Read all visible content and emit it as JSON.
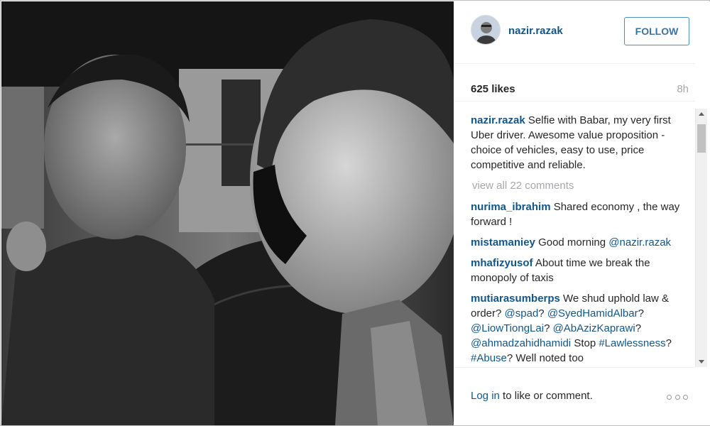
{
  "post": {
    "username": "nazir.razak",
    "follow_label": "FOLLOW",
    "likes": "625 likes",
    "time_ago": "8h",
    "caption_user": "nazir.razak",
    "caption_text": "Selfie with Babar, my very first Uber driver. Awesome value proposition - choice of vehicles, easy to use, price competitive and reliable.",
    "view_all": "view all 22 comments"
  },
  "comments": [
    {
      "user": "nurima_ibrahim",
      "text": "Shared economy , the way forward !"
    },
    {
      "user": "mistamaniey",
      "text": "Good morning",
      "mention": "@nazir.razak"
    },
    {
      "user": "mhafizyusof",
      "text": "About time we break the monopoly of taxis"
    }
  ],
  "long_comment": {
    "user": "mutiarasumberps",
    "t1": "We shud uphold law & order?",
    "m1": "@spad",
    "t2": "?",
    "m2": "@SyedHamidAlbar",
    "t3": "?",
    "m3": "@LiowTiongLai",
    "t4": "?",
    "m4": "@AbAzizKaprawi",
    "t5": "?",
    "m5": "@ahmadzahidhamidi",
    "t6": "Stop",
    "m6": "#Lawlessness",
    "t7": "?",
    "m7": "#Abuse",
    "t8": "? Well noted too"
  },
  "footer": {
    "login_link": "Log in",
    "login_rest": "to like or comment."
  },
  "icons": {
    "more": "more-options-icon",
    "avatar": "profile-avatar"
  },
  "colors": {
    "link_blue": "#125688",
    "follow_border": "#4c8fbc",
    "muted_gray": "#a5a7aa"
  }
}
